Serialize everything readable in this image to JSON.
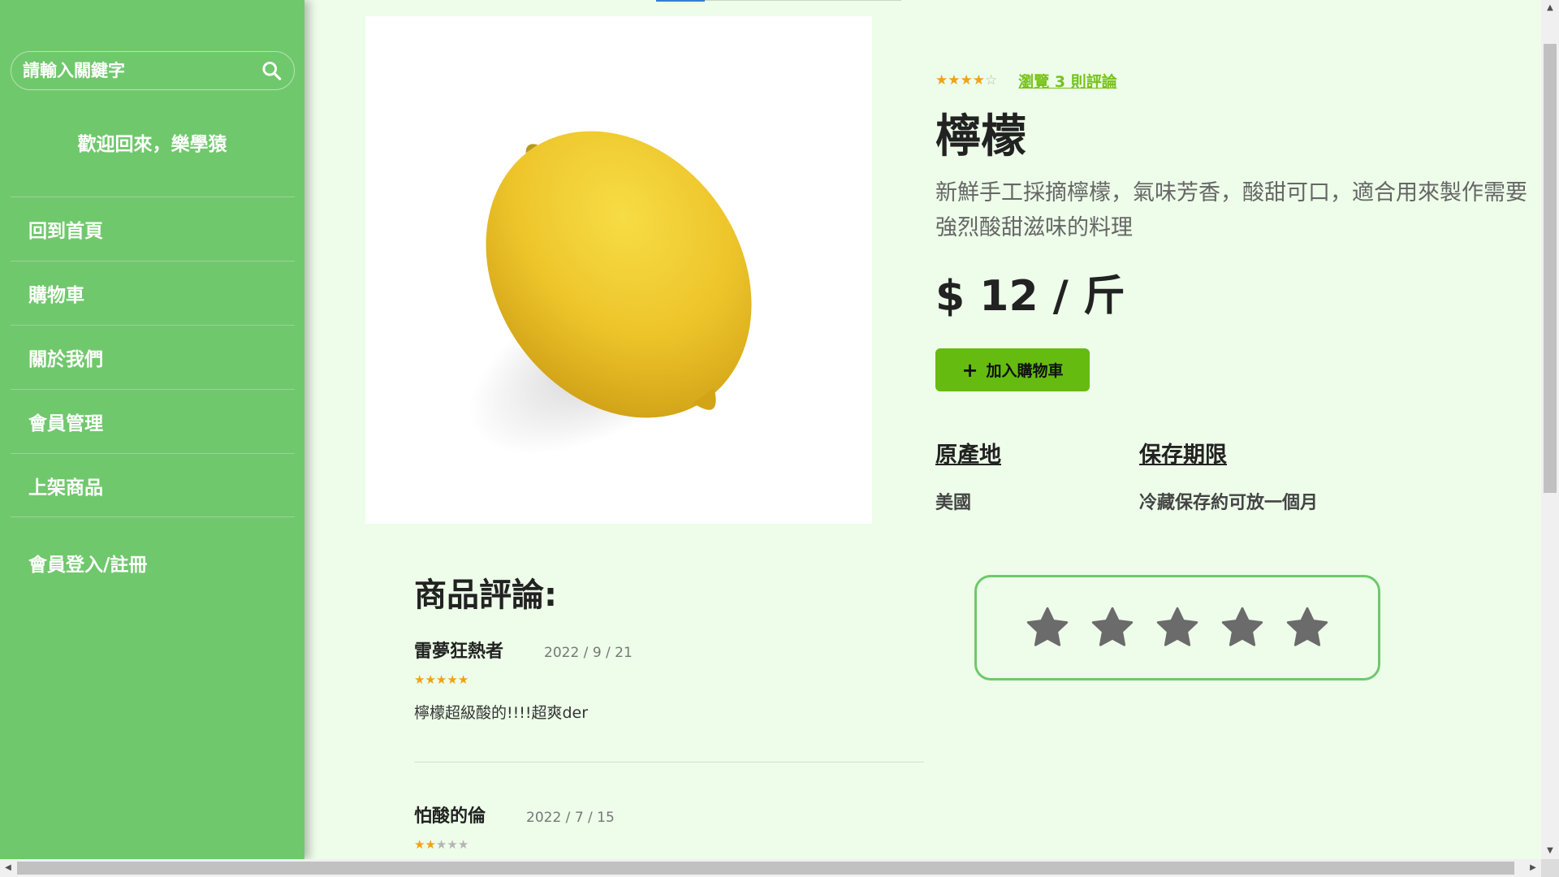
{
  "sidebar": {
    "search_placeholder": "請輸入關鍵字",
    "welcome": "歡迎回來，樂學猿",
    "items": [
      {
        "label": "回到首頁"
      },
      {
        "label": "購物車"
      },
      {
        "label": "關於我們"
      },
      {
        "label": "會員管理"
      },
      {
        "label": "上架商品"
      }
    ],
    "login": "會員登入/註冊"
  },
  "product": {
    "image_alt": "lemon",
    "rating": 4,
    "rating_max": 5,
    "review_link": "瀏覽 3 則評論",
    "title": "檸檬",
    "description": "新鮮手工採摘檸檬，氣味芳香，酸甜可口，適合用來製作需要強烈酸甜滋味的料理",
    "price": "$ 12 / 斤",
    "cart_icon": "plus-icon",
    "cart_button": "加入購物車",
    "attributes": [
      {
        "label": "原產地",
        "value": "美國"
      },
      {
        "label": "保存期限",
        "value": "冷藏保存約可放一個月"
      }
    ]
  },
  "reviews": {
    "title": "商品評論:",
    "items": [
      {
        "name": "雷夢狂熱者",
        "date": "2022 / 9 / 21",
        "rating": 5,
        "text": "檸檬超級酸的!!!!超爽der"
      },
      {
        "name": "怕酸的倫",
        "date": "2022 / 7 / 15",
        "rating": 2,
        "text": ""
      }
    ]
  },
  "rate_widget": {
    "stars": 5,
    "selected": 0
  },
  "colors": {
    "sidebar": "#70c86c",
    "background": "#edfde9",
    "accent": "#66bb10",
    "link": "#78c21a",
    "star": "#f2a116"
  }
}
